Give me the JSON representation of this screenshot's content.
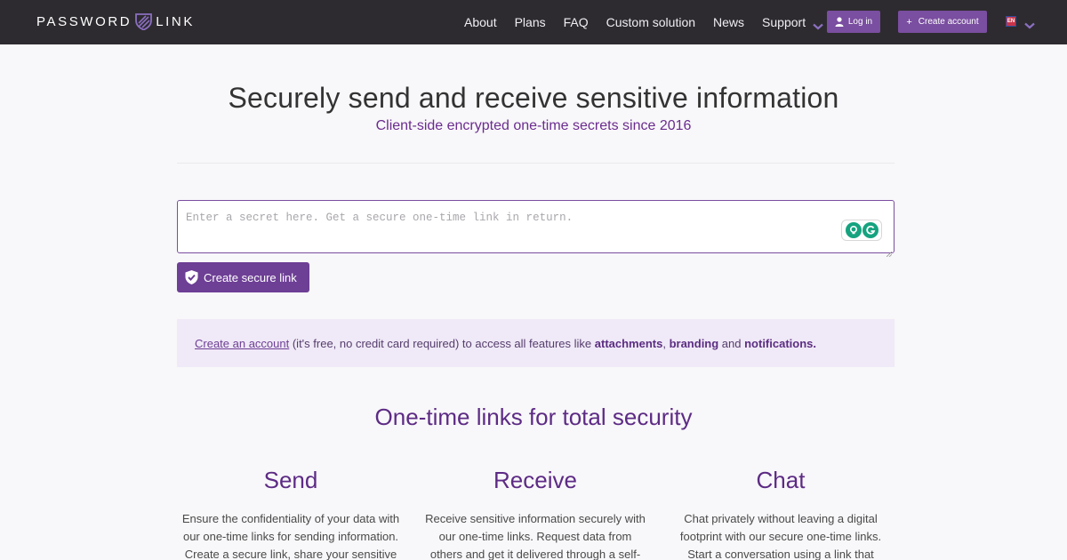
{
  "nav": {
    "brand_left": "PASSWORD",
    "brand_right": "LINK",
    "links": [
      "About",
      "Plans",
      "FAQ",
      "Custom solution",
      "News"
    ],
    "support_label": "Support",
    "login_label": "Log in",
    "create_account_label": "Create account",
    "lang_code": "EN"
  },
  "hero": {
    "title": "Securely send and receive sensitive information",
    "subtitle": "Client-side encrypted one-time secrets since 2016"
  },
  "form": {
    "secret_placeholder": "Enter a secret here. Get a secure one-time link in return.",
    "submit_label": "Create secure link"
  },
  "promo": {
    "link_text": "Create an account",
    "text_1": " (it's free, no credit card required) to access all features like ",
    "feature_1": "attachments",
    "sep_1": ", ",
    "feature_2": "branding",
    "sep_2": " and ",
    "feature_3": "notifications",
    "end": "."
  },
  "features": {
    "title": "One-time links for total security",
    "columns": [
      {
        "heading": "Send",
        "text": "Ensure the confidentiality of your data with our one-time links for sending information. Create a secure link, share your sensitive"
      },
      {
        "heading": "Receive",
        "text": "Receive sensitive information securely with our one-time links. Request data from others and get it delivered through a self-"
      },
      {
        "heading": "Chat",
        "text": "Chat privately without leaving a digital footprint with our secure one-time links. Start a conversation using a link that"
      }
    ]
  },
  "colors": {
    "navbar_bg": "#2d2b2f",
    "accent": "#7a4ea0",
    "accent_dark": "#6d3f95",
    "heading_purple": "#5d2b85",
    "promo_bg": "#f0e9f7",
    "page_bg": "#f8f7f9"
  }
}
